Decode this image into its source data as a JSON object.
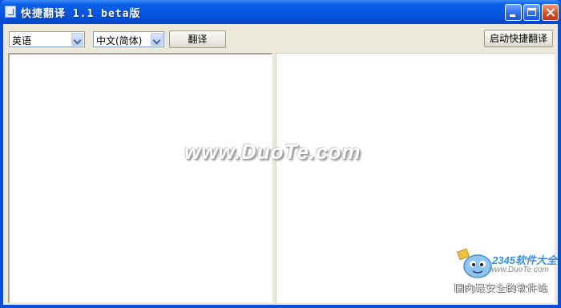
{
  "window": {
    "title": "快捷翻译 1.1 beta版",
    "controls": {
      "minimize": "minimize-icon",
      "maximize": "maximize-icon",
      "close": "close-icon"
    }
  },
  "toolbar": {
    "source_language": {
      "value": "英语",
      "icon": "chevron-down-icon"
    },
    "target_language": {
      "value": "中文(简体)",
      "icon": "chevron-down-icon"
    },
    "translate_label": "翻译",
    "quick_translate_label": "启动快捷翻译"
  },
  "panes": {
    "source_text": "",
    "result_text": ""
  },
  "watermark": {
    "site": "www.DuoTe.com",
    "brand": "2345软件大全",
    "url": "www.DuoTe.com",
    "slogan": "国内最安全的软件站"
  },
  "colors": {
    "titlebar": "#0555e0",
    "client_bg": "#ece9d8",
    "close_button": "#d8481d"
  }
}
